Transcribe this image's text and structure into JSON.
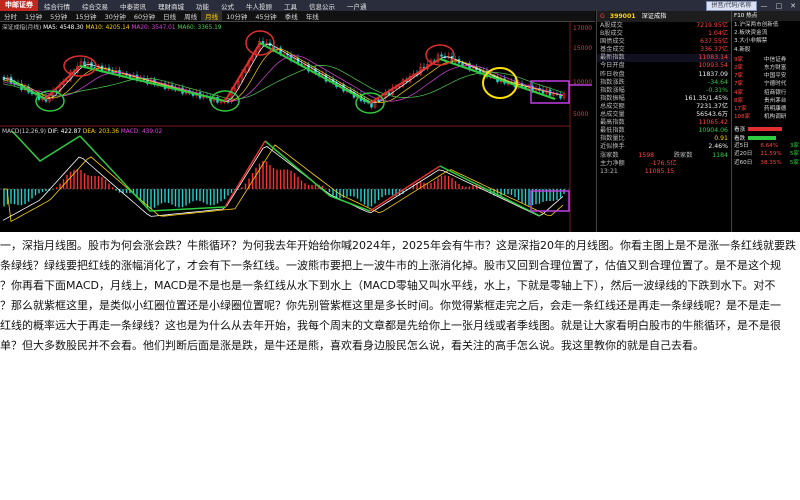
{
  "menubar": {
    "brand": "申邮证券",
    "items": [
      "综合行情",
      "综合交易",
      "中泰资讯",
      "理财商城",
      "功能",
      "公式",
      "牛人投顾",
      "工具",
      "信息公示",
      "一户通"
    ],
    "search_placeholder": "拼音/代码/名称",
    "window_controls": [
      "—",
      "□",
      "✕"
    ]
  },
  "periodbar": {
    "tabs": [
      "分时",
      "1分钟",
      "5分钟",
      "15分钟",
      "30分钟",
      "60分钟",
      "日线",
      "周线",
      "月线",
      "10分钟",
      "45分钟",
      "季线",
      "年线"
    ],
    "active": "月线"
  },
  "chart": {
    "index_name": "深证成指(月线)",
    "ma_labels": {
      "ma5": "MA5: 4548.30",
      "ma10": "MA10: 4205.14",
      "ma20": "MA20: 3547.01",
      "ma60": "MA60: 3365.19"
    },
    "y_ticks": [
      "17000",
      "15000",
      "10000",
      "5000"
    ],
    "macd_labels": {
      "name": "MACD(12,26,9)",
      "dif": "DIF: 422.87",
      "dea": "DEA: 203.36",
      "macd": "MACD: 439.02"
    }
  },
  "quote_panel": {
    "header": {
      "code_prefix": "G",
      "code": "399001",
      "name": "深证成指"
    },
    "rows": [
      {
        "label": "A股成交",
        "value": "7219.95亿",
        "cls": ""
      },
      {
        "label": "B股成交",
        "value": "1.04亿",
        "cls": ""
      },
      {
        "label": "国债成交",
        "value": "637.55亿",
        "cls": ""
      },
      {
        "label": "基金成交",
        "value": "336.37亿",
        "cls": ""
      },
      {
        "label": "最新指数",
        "value": "11083.14",
        "cls": ""
      },
      {
        "label": "今日开盘",
        "value": "10993.54",
        "cls": ""
      },
      {
        "label": "昨日收盘",
        "value": "11837.09",
        "cls": "w"
      },
      {
        "label": "指数涨跌",
        "value": "-34.64",
        "cls": "g"
      },
      {
        "label": "指数涨幅",
        "value": "-0.31%",
        "cls": "g"
      },
      {
        "label": "指数振幅",
        "value": "161.35/1.45%",
        "cls": "w"
      },
      {
        "label": "总成交额",
        "value": "7231.37亿",
        "cls": "w"
      },
      {
        "label": "总成交量",
        "value": "56543.6万",
        "cls": "w"
      },
      {
        "label": "最高指数",
        "value": "11065.42",
        "cls": ""
      },
      {
        "label": "最低指数",
        "value": "10904.06",
        "cls": "g"
      },
      {
        "label": "指数量比",
        "value": "0.91",
        "cls": "y"
      },
      {
        "label": "近似换手",
        "value": "2.46%",
        "cls": "w"
      }
    ],
    "bottom": [
      {
        "label": "涨家数",
        "value": "1598",
        "label2": "跌家数",
        "value2": "1184"
      },
      {
        "label": "主力净额",
        "value": "-176.5亿",
        "label2": "",
        "value2": ""
      },
      {
        "label": "13:21",
        "value": "11085.15",
        "label2": "",
        "value2": ""
      }
    ]
  },
  "right_panel": {
    "title": "F10 热点",
    "items": [
      "1.沪深两市创新低",
      "2.板块资金流",
      "3.大小非解禁",
      "4.新股"
    ],
    "stats": [
      {
        "a": "9家",
        "b": "中信证券"
      },
      {
        "a": "2家",
        "b": "东方财富"
      },
      {
        "a": "7家",
        "b": "中国平安"
      },
      {
        "a": "7家",
        "b": "宁德时代"
      },
      {
        "a": "4家",
        "b": "招商银行"
      },
      {
        "a": "8家",
        "b": "贵州茅台"
      },
      {
        "a": "17家",
        "b": "药明康德"
      },
      {
        "a": "108家",
        "b": "机构调研"
      }
    ],
    "bar_labels": [
      "看涨",
      "看跌"
    ],
    "bar_colors": [
      "#e03030",
      "#2ecc40"
    ],
    "footer": [
      {
        "l": "近5日",
        "r": "6.64%",
        "g": "3家"
      },
      {
        "l": "近20日",
        "r": "11.59%",
        "g": "5家"
      },
      {
        "l": "近60日",
        "r": "38.35%",
        "g": "5家"
      }
    ]
  },
  "article": {
    "lines": [
      "一，深指月线图。股市为何会涨会跌？牛熊循环？为何我去年开始给你喊2024年，2025年会有牛市？这是深指20年的月线图。你看主图上是不是涨一条红线就要跌",
      "条绿线？绿线要把红线的涨幅消化了，才会有下一条红线。一波熊市要把上一波牛市的上涨消化掉。股市又回到合理位置了，估值又到合理位置了。是不是这个规",
      "？你再看下面MACD，月线上，MACD是不是也是一条红线从水下到水上（MACD零轴又叫水平线，水上，下就是零轴上下），然后一波绿线的下跌到水下。对不",
      "？那么就紫框这里，是类似小红圈位置还是小绿圈位置呢？你先别管紫框这里是多长时间。你觉得紫框走完之后，会走一条红线还是再走一条绿线呢？是不是走一",
      "红线的概率远大于再走一条绿线？这也是为什么从去年开始，我每个周末的文章都是先给你上一张月线或者季线图。就是让大家看明白股市的牛熊循环，是不是很",
      "单？但大多数股民并不会看。他们判断后面是涨是跌，是牛还是熊，喜欢看身边股民怎么说，看关注的高手怎么说。我这里教你的就是自己去看。"
    ]
  }
}
